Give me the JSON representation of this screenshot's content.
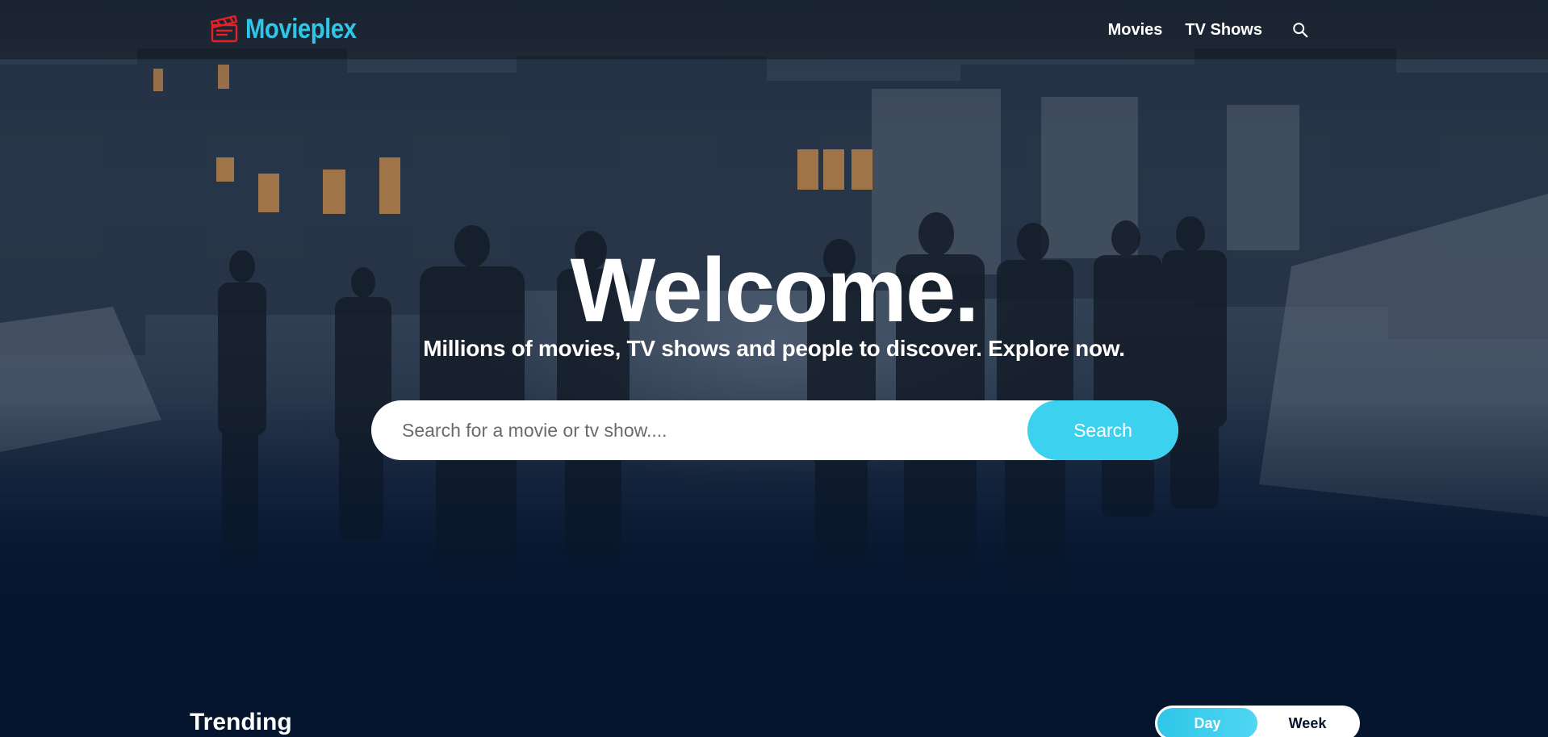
{
  "header": {
    "logo_text": "Movieplex",
    "nav": [
      {
        "label": "Movies"
      },
      {
        "label": "TV Shows"
      }
    ]
  },
  "hero": {
    "title": "Welcome.",
    "subtitle": "Millions of movies, TV shows and people to discover. Explore now.",
    "search": {
      "placeholder": "Search for a movie or tv show....",
      "value": "",
      "button_label": "Search"
    }
  },
  "trending": {
    "title": "Trending",
    "toggle": {
      "options": [
        "Day",
        "Week"
      ],
      "selected": "Day"
    }
  },
  "colors": {
    "accent": "#2fc6e8",
    "search_button": "#3bd1ef",
    "background": "#04152d",
    "logo_icon": "#e32227"
  },
  "icons": {
    "logo": "clapperboard-icon",
    "nav_search": "search-icon"
  }
}
